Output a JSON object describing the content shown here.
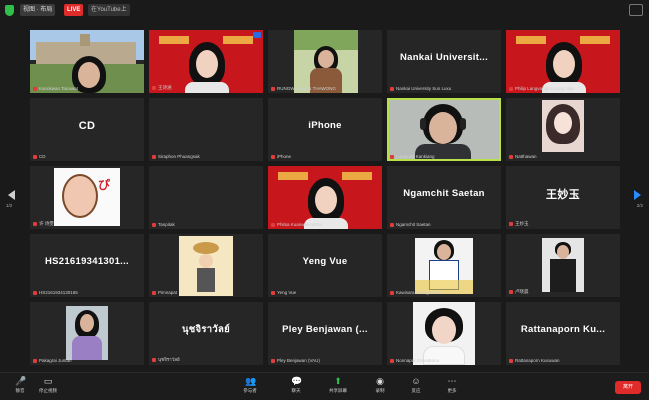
{
  "topbar": {
    "view_label": "视图 · 布局",
    "rec_label": "LIVE",
    "rec2_label": "在YouTube上"
  },
  "tiles": [
    {
      "label": "Kanokwan Tanawat",
      "name": "",
      "type": "photo-building"
    },
    {
      "label": "王诗涵",
      "name": "",
      "type": "photo-red",
      "badge": true
    },
    {
      "label": "RUNGWALIWAN THAWONG",
      "name": "",
      "type": "photo-green"
    },
    {
      "label": "Nankai University Sun Luxu",
      "name": "Nankai  Universit...",
      "type": "text"
    },
    {
      "label": "Philip Langvangmu Long Nan",
      "name": "",
      "type": "photo-red2"
    },
    {
      "label": "CD",
      "name": "CD",
      "type": "text"
    },
    {
      "label": "Siraphon Phuangsak",
      "name": "",
      "type": "blank"
    },
    {
      "label": "iPhone",
      "name": "iPhone",
      "type": "text"
    },
    {
      "label": "Lungmak Kankiang",
      "name": "",
      "type": "photo-headset",
      "active": true
    },
    {
      "label": "Natthawan",
      "name": "",
      "type": "photo-anime"
    },
    {
      "label": "许 诗雯",
      "name": "",
      "type": "photo-cartoon"
    },
    {
      "label": "Tanpitak",
      "name": "",
      "type": "blank"
    },
    {
      "label": "Phitsa Kuanweesattha",
      "name": "",
      "type": "photo-red3"
    },
    {
      "label": "Ngamchit Saetan",
      "name": "Ngamchit  Saetan",
      "type": "text"
    },
    {
      "label": "王妙玉",
      "name": "王妙玉",
      "type": "text"
    },
    {
      "label": "HS2161934130165",
      "name": "HS21619341301...",
      "type": "text"
    },
    {
      "label": "Pimnapat",
      "name": "",
      "type": "photo-sketch"
    },
    {
      "label": "Yeng Vue",
      "name": "Yeng Vue",
      "type": "text"
    },
    {
      "label": "Kawisara Saengsanoh",
      "name": "",
      "type": "photo-uniform"
    },
    {
      "label": "卢晓晨",
      "name": "",
      "type": "photo-suit"
    },
    {
      "label": "Pakagrai Juntan",
      "name": "",
      "type": "photo-girl"
    },
    {
      "label": "นุชจิราวัลย์",
      "name": "นุชจิราวัลย์",
      "type": "text-thai"
    },
    {
      "label": "Pley Benjawan (VAU)",
      "name": "Pley  Benjawan  (...",
      "type": "text"
    },
    {
      "label": "Nonnapat Siriwattana",
      "name": "",
      "type": "photo-short"
    },
    {
      "label": "Rattanaporn Kusuwan",
      "name": "Rattanaporn  Ku...",
      "type": "text"
    }
  ],
  "nav": {
    "left_page": "1/2",
    "right_page": "2/2"
  },
  "bottombar": {
    "items": [
      {
        "label": "静音",
        "icon": "mic-icon"
      },
      {
        "label": "停止视频",
        "icon": "video-icon"
      },
      {
        "label": "参与者",
        "icon": "participants-icon"
      },
      {
        "label": "聊天",
        "icon": "chat-icon"
      },
      {
        "label": "共享屏幕",
        "icon": "share-icon"
      },
      {
        "label": "录制",
        "icon": "record-icon"
      },
      {
        "label": "反应",
        "icon": "reactions-icon"
      },
      {
        "label": "更多",
        "icon": "more-icon"
      }
    ],
    "end_label": "离开"
  },
  "colors": {
    "active_speaker": "#b8e04a",
    "end": "#e02b2b",
    "red_bg": "#c8161d"
  }
}
